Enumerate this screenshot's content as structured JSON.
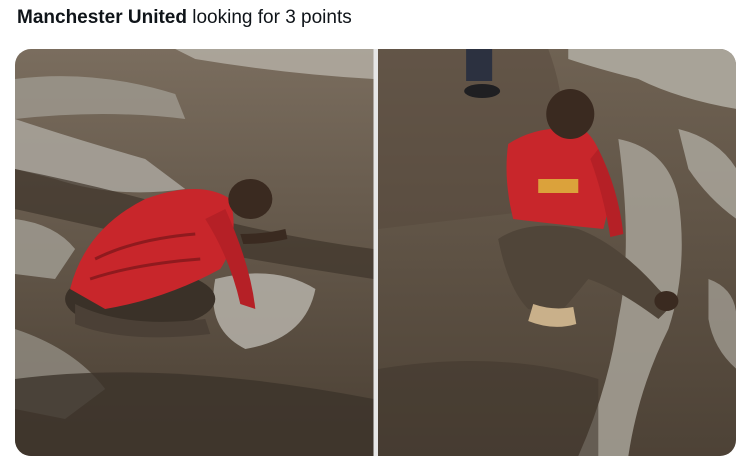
{
  "tweet": {
    "text_bold": "Manchester United",
    "text_rest": " looking for 3 points"
  },
  "media": [
    {
      "name": "photo-man-kneeling-in-mud-puddle"
    },
    {
      "name": "photo-man-sitting-in-mud"
    }
  ],
  "colors": {
    "mud_dark": "#4a3f33",
    "mud_mid": "#6b5c4b",
    "water": "#a9a59c",
    "jersey_red": "#c8262b",
    "skin": "#3a2a20"
  }
}
